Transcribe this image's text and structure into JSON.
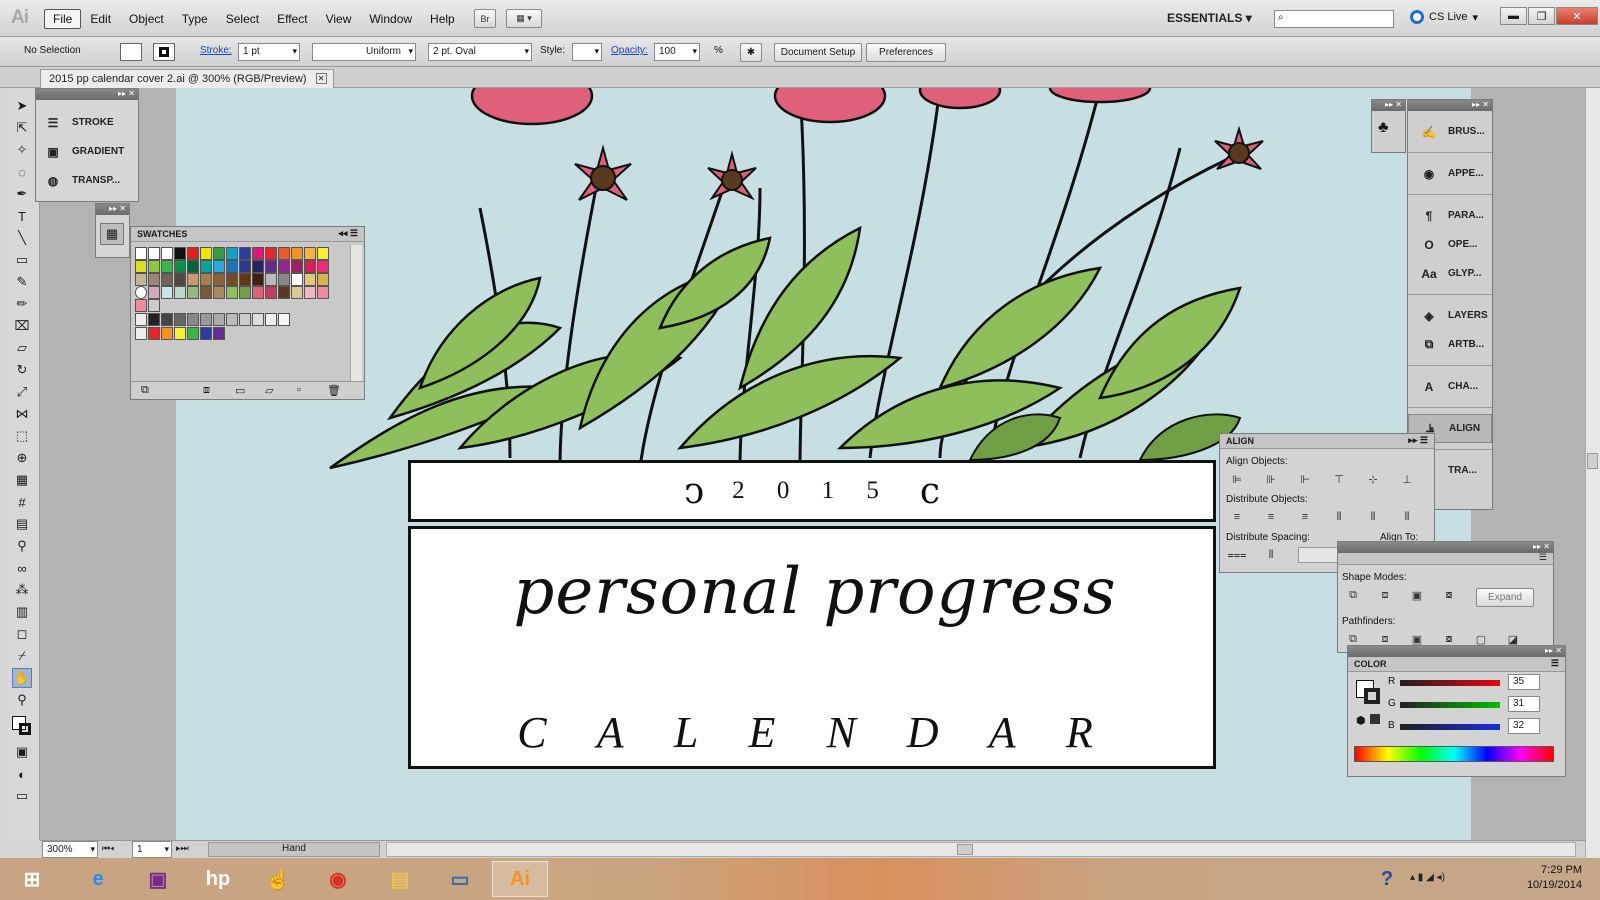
{
  "menubar": {
    "app_logo": "Ai",
    "items": [
      "File",
      "Edit",
      "Object",
      "Type",
      "Select",
      "Effect",
      "View",
      "Window",
      "Help"
    ],
    "bridge_label": "Br",
    "workspace": "ESSENTIALS",
    "cs_live": "CS Live"
  },
  "control_bar": {
    "selection": "No Selection",
    "stroke_label": "Stroke:",
    "stroke_weight": "1 pt",
    "profile": "Uniform",
    "brush": "2 pt. Oval",
    "style_label": "Style:",
    "opacity_label": "Opacity:",
    "opacity_value": "100",
    "percent": "%",
    "document_setup": "Document Setup",
    "preferences": "Preferences"
  },
  "document": {
    "tab_title": "2015 pp calendar cover 2.ai @ 300% (RGB/Preview)"
  },
  "artwork": {
    "year": "2 0 1 5",
    "title": "personal progress",
    "subtitle": "C A L E N D A R"
  },
  "panels": {
    "stroke": "STROKE",
    "gradient": "GRADIENT",
    "transparency": "TRANSP...",
    "swatches_title": "SWATCHES",
    "dock_items": [
      "BRUS...",
      "APPE...",
      "PARA...",
      "OPE...",
      "GLYP...",
      "LAYERS",
      "ARTB...",
      "CHA...",
      "ALIGN",
      "TRA..."
    ],
    "align": {
      "title": "ALIGN",
      "align_objects": "Align Objects:",
      "distribute_objects": "Distribute Objects:",
      "distribute_spacing": "Distribute Spacing:",
      "align_to": "Align To:"
    },
    "pathfinder": {
      "shape_modes": "Shape Modes:",
      "expand": "Expand",
      "pathfinders": "Pathfinders:"
    },
    "color": {
      "title": "COLOR",
      "r_label": "R",
      "g_label": "G",
      "b_label": "B",
      "r": "35",
      "g": "31",
      "b": "32"
    }
  },
  "statusbar": {
    "zoom": "300%",
    "artboard": "1",
    "tool": "Hand"
  },
  "taskbar": {
    "time": "7:29 PM",
    "date": "10/19/2014"
  },
  "colors": {
    "artboard_bg": "#c7dfe3",
    "leaf": "#8fbf5a",
    "flower": "#e0607c"
  }
}
